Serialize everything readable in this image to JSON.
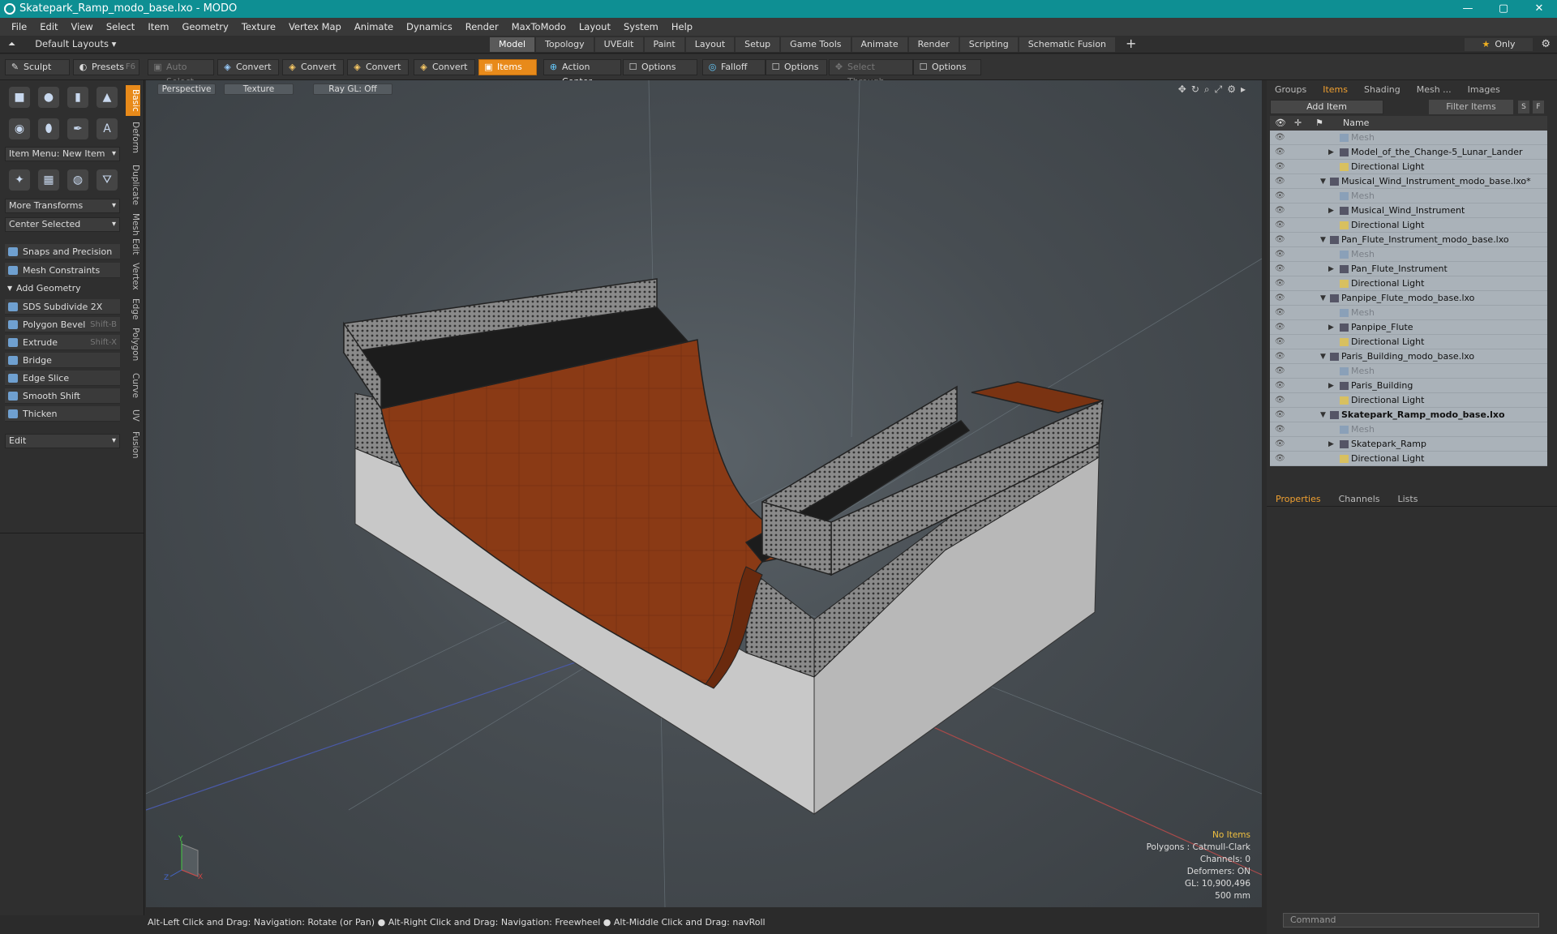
{
  "window": {
    "title": "Skatepark_Ramp_modo_base.lxo - MODO",
    "buttons": [
      "—",
      "▢",
      "✕"
    ]
  },
  "menu": [
    "File",
    "Edit",
    "View",
    "Select",
    "Item",
    "Geometry",
    "Texture",
    "Vertex Map",
    "Animate",
    "Dynamics",
    "Render",
    "MaxToModo",
    "Layout",
    "System",
    "Help"
  ],
  "layout_bar": {
    "layouts_label": "Default Layouts",
    "tabs": [
      "Model",
      "Topology",
      "UVEdit",
      "Paint",
      "Layout",
      "Setup",
      "Game Tools",
      "Animate",
      "Render",
      "Scripting",
      "Schematic Fusion"
    ],
    "active_tab": "Model",
    "plus": "+",
    "only_label": "Only",
    "gear": "⚙"
  },
  "toolbar": {
    "sculpt": "Sculpt",
    "presets": "Presets",
    "presets_key": "F6",
    "auto_select": "Auto Select",
    "convert": "Convert",
    "items": "Items",
    "action_center": "Action Center",
    "options": "Options",
    "falloff": "Falloff",
    "select_through": "Select Through"
  },
  "left_panel": {
    "vtabs": [
      "Basic",
      "Deform",
      "Duplicate",
      "Mesh Edit",
      "Vertex",
      "Edge",
      "Polygon",
      "Curve",
      "UV",
      "Fusion"
    ],
    "item_menu": "Item Menu: New Item",
    "more_transforms": "More Transforms",
    "center_selected": "Center Selected",
    "snaps": "Snaps and Precision",
    "mesh_constraints": "Mesh Constraints",
    "add_geometry": "Add Geometry",
    "tools": [
      {
        "label": "SDS Subdivide 2X",
        "shortcut": ""
      },
      {
        "label": "Polygon Bevel",
        "shortcut": "Shift-B"
      },
      {
        "label": "Extrude",
        "shortcut": "Shift-X"
      },
      {
        "label": "Bridge",
        "shortcut": ""
      },
      {
        "label": "Edge Slice",
        "shortcut": ""
      },
      {
        "label": "Smooth Shift",
        "shortcut": ""
      },
      {
        "label": "Thicken",
        "shortcut": ""
      }
    ],
    "edit": "Edit"
  },
  "viewport": {
    "view": "Perspective",
    "shading": "Texture",
    "raygl": "Ray GL: Off",
    "info": {
      "items": "No Items",
      "polygons": "Polygons : Catmull-Clark",
      "channels": "Channels: 0",
      "deformers": "Deformers: ON",
      "gl": "GL: 10,900,496",
      "size": "500 mm"
    },
    "axis": {
      "x": "X",
      "y": "Y",
      "z": "Z"
    }
  },
  "status": "Alt-Left Click and Drag: Navigation: Rotate (or Pan) ● Alt-Right Click and Drag: Navigation: Freewheel ● Alt-Middle Click and Drag: navRoll",
  "right_panel": {
    "tabs": [
      "Groups",
      "Items",
      "Shading",
      "Mesh ...",
      "Images"
    ],
    "active": "Items",
    "add_item": "Add Item",
    "filter": "Filter Items",
    "s": "S",
    "f": "F",
    "name_col": "Name",
    "rows": [
      {
        "label": "Mesh",
        "indent": 2,
        "type": "mesh"
      },
      {
        "label": "Model_of_the_Change-5_Lunar_Lander",
        "indent": 2,
        "type": "item"
      },
      {
        "label": "Directional Light",
        "indent": 2,
        "type": "light"
      },
      {
        "label": "Musical_Wind_Instrument_modo_base.lxo*",
        "indent": 1,
        "type": "scene"
      },
      {
        "label": "Mesh",
        "indent": 2,
        "type": "mesh"
      },
      {
        "label": "Musical_Wind_Instrument",
        "indent": 2,
        "type": "item"
      },
      {
        "label": "Directional Light",
        "indent": 2,
        "type": "light"
      },
      {
        "label": "Pan_Flute_Instrument_modo_base.lxo",
        "indent": 1,
        "type": "scene"
      },
      {
        "label": "Mesh",
        "indent": 2,
        "type": "mesh"
      },
      {
        "label": "Pan_Flute_Instrument",
        "indent": 2,
        "type": "item"
      },
      {
        "label": "Directional Light",
        "indent": 2,
        "type": "light"
      },
      {
        "label": "Panpipe_Flute_modo_base.lxo",
        "indent": 1,
        "type": "scene"
      },
      {
        "label": "Mesh",
        "indent": 2,
        "type": "mesh"
      },
      {
        "label": "Panpipe_Flute",
        "indent": 2,
        "type": "item"
      },
      {
        "label": "Directional Light",
        "indent": 2,
        "type": "light"
      },
      {
        "label": "Paris_Building_modo_base.lxo",
        "indent": 1,
        "type": "scene"
      },
      {
        "label": "Mesh",
        "indent": 2,
        "type": "mesh"
      },
      {
        "label": "Paris_Building",
        "indent": 2,
        "type": "item"
      },
      {
        "label": "Directional Light",
        "indent": 2,
        "type": "light"
      },
      {
        "label": "Skatepark_Ramp_modo_base.lxo",
        "indent": 1,
        "type": "scene-bold"
      },
      {
        "label": "Mesh",
        "indent": 2,
        "type": "mesh"
      },
      {
        "label": "Skatepark_Ramp",
        "indent": 2,
        "type": "item"
      },
      {
        "label": "Directional Light",
        "indent": 2,
        "type": "light"
      }
    ],
    "prop_tabs": [
      "Properties",
      "Channels",
      "Lists"
    ],
    "prop_active": "Properties",
    "command_placeholder": "Command"
  }
}
